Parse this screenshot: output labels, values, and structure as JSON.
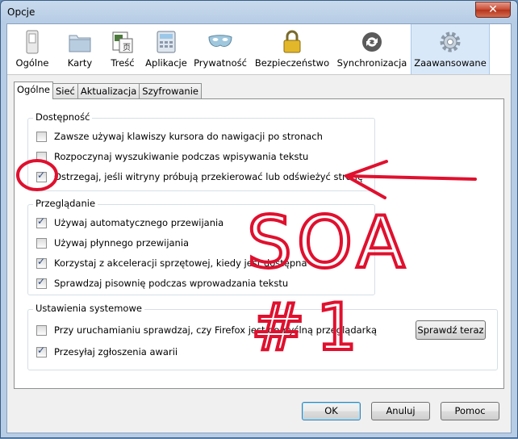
{
  "window": {
    "title": "Opcje",
    "close_glyph": "✕"
  },
  "toolbar": {
    "items": [
      {
        "label": "Ogólne",
        "icon": "switch-icon"
      },
      {
        "label": "Karty",
        "icon": "folder-tabs-icon"
      },
      {
        "label": "Treść",
        "icon": "content-icon"
      },
      {
        "label": "Aplikacje",
        "icon": "applications-icon"
      },
      {
        "label": "Prywatność",
        "icon": "mask-icon"
      },
      {
        "label": "Bezpieczeństwo",
        "icon": "padlock-icon"
      },
      {
        "label": "Synchronizacja",
        "icon": "sync-icon"
      },
      {
        "label": "Zaawansowane",
        "icon": "gear-icon"
      }
    ],
    "active": "Zaawansowane"
  },
  "tabs": [
    "Ogólne",
    "Sieć",
    "Aktualizacja",
    "Szyfrowanie"
  ],
  "groups": {
    "accessibility": {
      "title": "Dostępność",
      "options": [
        {
          "label": "Zawsze używaj klawiszy kursora do nawigacji po stronach",
          "checked": false
        },
        {
          "label": "Rozpoczynaj wyszukiwanie podczas wpisywania tekstu",
          "checked": false
        },
        {
          "label": "Ostrzegaj, jeśli witryny próbują przekierować lub odświeżyć stronę",
          "checked": true
        }
      ]
    },
    "browsing": {
      "title": "Przeglądanie",
      "options": [
        {
          "label": "Używaj automatycznego przewijania",
          "checked": true
        },
        {
          "label": "Używaj płynnego przewijania",
          "checked": false
        },
        {
          "label": "Korzystaj z akceleracji sprzętowej, kiedy jest dostępna",
          "checked": true
        },
        {
          "label": "Sprawdzaj pisownię podczas wprowadzania tekstu",
          "checked": true
        }
      ]
    },
    "system": {
      "title": "Ustawienia systemowe",
      "options": [
        {
          "label": "Przy uruchamianiu sprawdzaj, czy Firefox jest domyślną przeglądarką",
          "checked": false
        },
        {
          "label": "Przesyłaj zgłoszenia awarii",
          "checked": true
        }
      ],
      "check_now_label": "Sprawdź teraz"
    }
  },
  "buttons": {
    "ok": "OK",
    "cancel": "Anuluj",
    "help": "Pomoc"
  },
  "annotation": {
    "text_line1": "SOA",
    "text_line2": "#1",
    "color": "#e0102e"
  }
}
